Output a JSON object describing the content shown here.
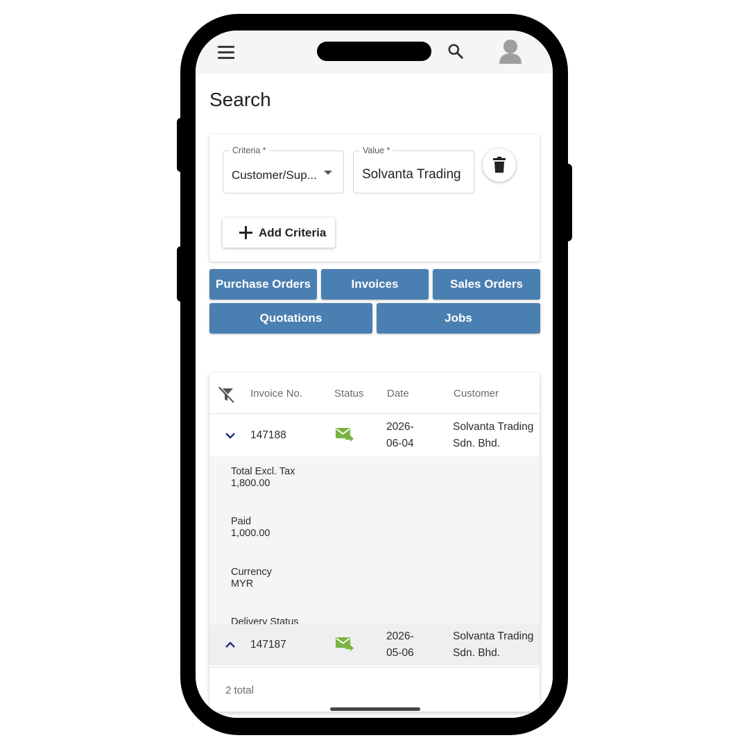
{
  "page": {
    "title": "Search"
  },
  "header": {
    "icons": [
      "menu-icon",
      "search-icon",
      "avatar-icon"
    ]
  },
  "criteria": {
    "criteria_label": "Criteria *",
    "criteria_value": "Customer/Sup...",
    "value_label": "Value *",
    "value_value": "Solvanta Trading",
    "add_button": "Add Criteria"
  },
  "doc_buttons": [
    "Purchase Orders",
    "Invoices",
    "Sales Orders",
    "Quotations",
    "Jobs"
  ],
  "table": {
    "columns": [
      "Invoice No.",
      "Status",
      "Date",
      "Customer"
    ],
    "rows": [
      {
        "invoice": "147188",
        "status_icon": "email-sent-icon",
        "date": "2026-06-04",
        "customer": "Solvanta Trading Sdn. Bhd.",
        "expanded": true,
        "details": [
          {
            "label": "Total Excl. Tax",
            "value": "1,800.00"
          },
          {
            "label": "Paid",
            "value": "1,000.00"
          },
          {
            "label": "Currency",
            "value": "MYR"
          },
          {
            "label": "Delivery Status",
            "value": ""
          }
        ]
      },
      {
        "invoice": "147187",
        "status_icon": "email-sent-icon",
        "date": "2026-05-06",
        "customer": "Solvanta Trading Sdn. Bhd.",
        "expanded": false
      }
    ],
    "footer": "2 total"
  },
  "colors": {
    "primary_button": "#4a7fb2",
    "status_icon": "#7cb342",
    "chevron": "#1a2f7a"
  }
}
